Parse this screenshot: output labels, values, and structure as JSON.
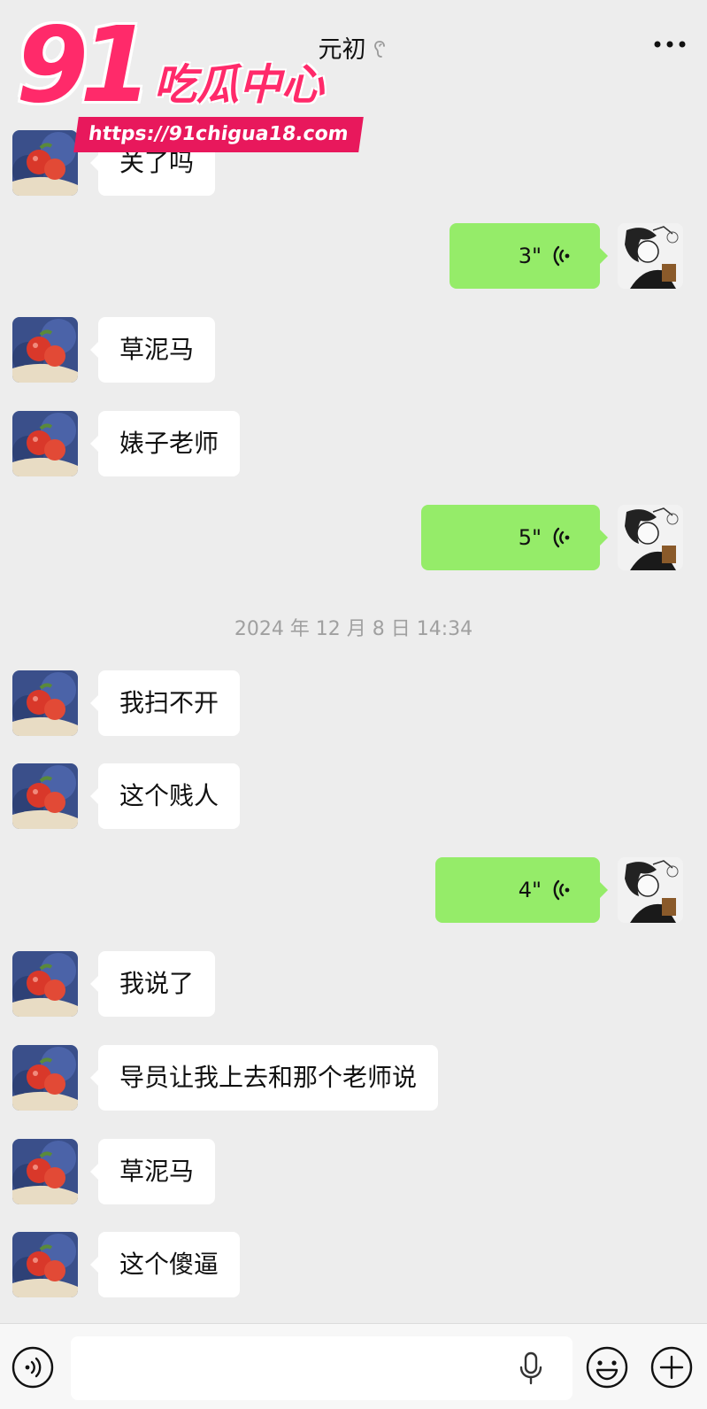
{
  "header": {
    "title": "元初",
    "ear_icon": "ear-icon",
    "more_icon": "more-dots-icon"
  },
  "watermark": {
    "number": "91",
    "text": "吃瓜中心",
    "url": "https://91chigua18.com"
  },
  "messages": [
    {
      "side": "left",
      "text": "关了吗"
    },
    {
      "side": "right",
      "type": "voice",
      "duration": "3\""
    },
    {
      "side": "left",
      "text": "草泥马"
    },
    {
      "side": "left",
      "text": "婊子老师"
    },
    {
      "side": "right",
      "type": "voice",
      "duration": "5\""
    },
    {
      "side": "left",
      "text": "我扫不开"
    },
    {
      "side": "left",
      "text": "这个贱人"
    },
    {
      "side": "right",
      "type": "voice",
      "duration": "4\""
    },
    {
      "side": "left",
      "text": "我说了"
    },
    {
      "side": "left",
      "text": "导员让我上去和那个老师说"
    },
    {
      "side": "left",
      "text": "草泥马"
    },
    {
      "side": "left",
      "text": "这个傻逼"
    }
  ],
  "timestamp": "2024 年 12 月 8 日 14:34",
  "input_bar": {
    "input_value": "",
    "voice_mode_icon": "voice-mode-icon",
    "mic_icon": "microphone-icon",
    "emoji_icon": "emoji-icon",
    "plus_icon": "plus-icon"
  },
  "colors": {
    "background": "#ededed",
    "sent_bubble": "#95ec69",
    "received_bubble": "#ffffff",
    "watermark_pink": "#ff2a6a"
  }
}
